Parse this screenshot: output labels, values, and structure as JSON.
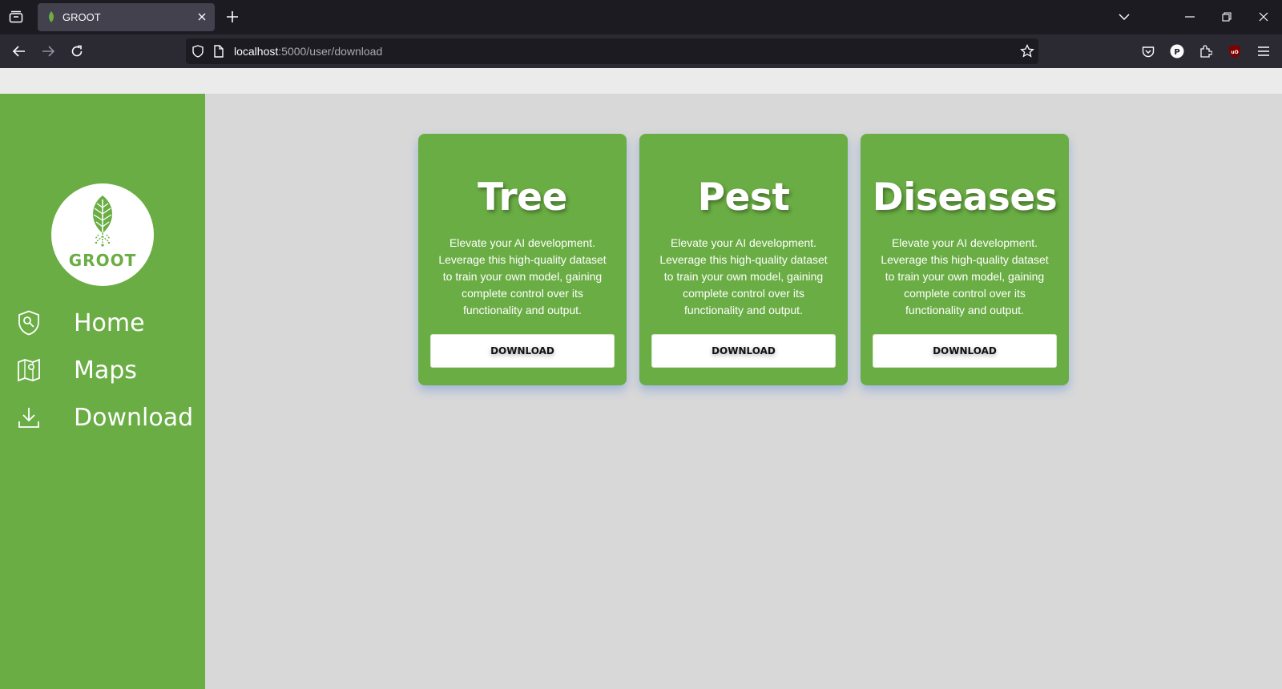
{
  "browser": {
    "tab_title": "GROOT",
    "url_host": "localhost",
    "url_path": ":5000/user/download"
  },
  "sidebar": {
    "logo_text": "GROOT",
    "items": [
      {
        "label": "Home",
        "icon": "shield-location-icon"
      },
      {
        "label": "Maps",
        "icon": "map-icon"
      },
      {
        "label": "Download",
        "icon": "download-icon"
      }
    ]
  },
  "cards": [
    {
      "title": "Tree",
      "description": "Elevate your AI development. Leverage this high-quality dataset to train your own model, gaining complete control over its functionality and output.",
      "button": "DOWNLOAD"
    },
    {
      "title": "Pest",
      "description": "Elevate your AI development. Leverage this high-quality dataset to train your own model, gaining complete control over its functionality and output.",
      "button": "DOWNLOAD"
    },
    {
      "title": "Diseases",
      "description": "Elevate your AI development. Leverage this high-quality dataset to train your own model, gaining complete control over its functionality and output.",
      "button": "DOWNLOAD"
    }
  ],
  "colors": {
    "brand_green": "#6aad44",
    "page_bg": "#d8d8d8"
  }
}
